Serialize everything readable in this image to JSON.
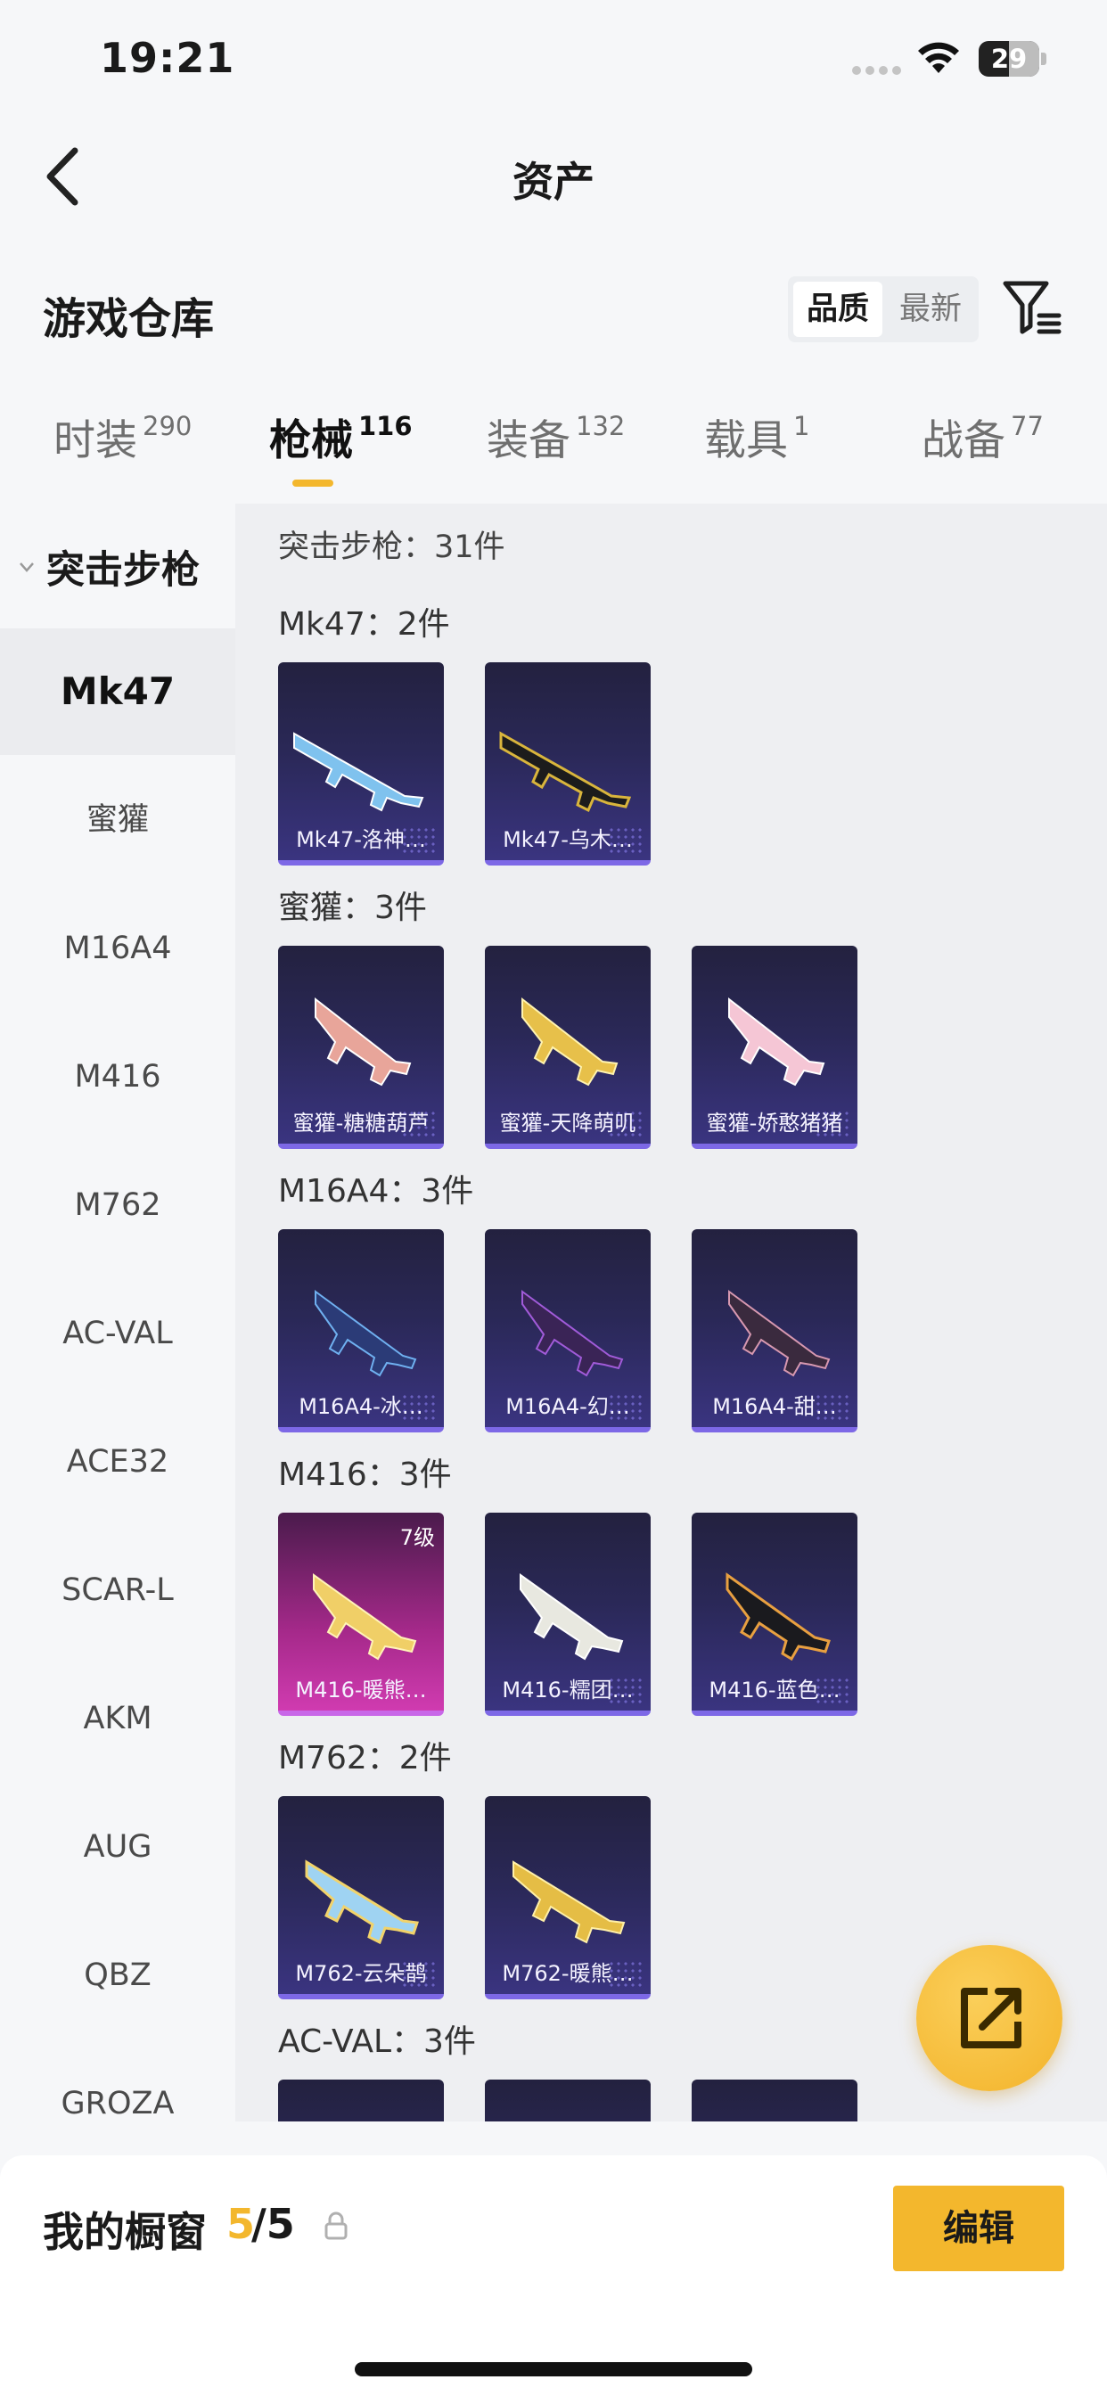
{
  "status_bar": {
    "time": "19:21",
    "battery": "29"
  },
  "nav": {
    "title": "资产"
  },
  "warehouse": {
    "title": "游戏仓库",
    "sort_options": [
      "品质",
      "最新"
    ]
  },
  "tabs": [
    {
      "label": "时装",
      "count": "290"
    },
    {
      "label": "枪械",
      "count": "116"
    },
    {
      "label": "装备",
      "count": "132"
    },
    {
      "label": "载具",
      "count": "1"
    },
    {
      "label": "战备",
      "count": "77"
    }
  ],
  "sidebar": {
    "group": "突击步枪",
    "items": [
      "Mk47",
      "蜜獾",
      "M16A4",
      "M416",
      "M762",
      "AC-VAL",
      "ACE32",
      "SCAR-L",
      "AKM",
      "AUG",
      "QBZ",
      "GROZA"
    ]
  },
  "main": {
    "header": "突击步枪：31件",
    "groups": [
      {
        "label": "Mk47：2件",
        "cards": [
          "Mk47-洛神…",
          "Mk47-乌木…"
        ]
      },
      {
        "label": "蜜獾：3件",
        "cards": [
          "蜜獾-糖糖葫芦",
          "蜜獾-天降萌叽",
          "蜜獾-娇憨猪猪"
        ]
      },
      {
        "label": "M16A4：3件",
        "cards": [
          "M16A4-冰…",
          "M16A4-幻…",
          "M16A4-甜…"
        ]
      },
      {
        "label": "M416：3件",
        "cards": [
          "M416-暖熊…",
          "M416-糯团…",
          "M416-蓝色…"
        ],
        "level_badge": "7级"
      },
      {
        "label": "M762：2件",
        "cards": [
          "M762-云朵鹊",
          "M762-暖熊…"
        ]
      },
      {
        "label": "AC-VAL：3件",
        "cards": [
          "",
          "",
          ""
        ]
      }
    ]
  },
  "bottom": {
    "showcase_label": "我的橱窗",
    "count_current": "5",
    "count_total": "/5",
    "edit_label": "编辑"
  },
  "colors": {
    "accent": "#f3b72d",
    "card_bg": "#2a2857",
    "card_edge": "#7d68e6",
    "legendary_card": "#a5298a"
  }
}
